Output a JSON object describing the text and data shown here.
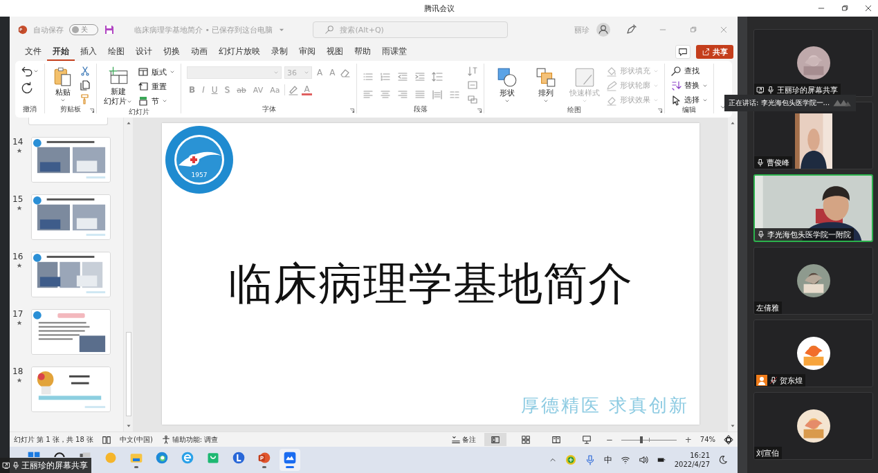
{
  "meeting_window": {
    "title": "腾讯会议"
  },
  "ppt": {
    "autosave": {
      "label": "自动保存",
      "on": false,
      "state_text": "关"
    },
    "document_title": "临床病理学基地简介 • 已保存到这台电脑",
    "search": {
      "placeholder": "搜索(Alt+Q)"
    },
    "user_name": "丽珍",
    "tabs": [
      {
        "label": "文件",
        "selected": false
      },
      {
        "label": "开始",
        "selected": true
      },
      {
        "label": "插入",
        "selected": false
      },
      {
        "label": "绘图",
        "selected": false
      },
      {
        "label": "设计",
        "selected": false
      },
      {
        "label": "切换",
        "selected": false
      },
      {
        "label": "动画",
        "selected": false
      },
      {
        "label": "幻灯片放映",
        "selected": false
      },
      {
        "label": "录制",
        "selected": false
      },
      {
        "label": "审阅",
        "selected": false
      },
      {
        "label": "视图",
        "selected": false
      },
      {
        "label": "帮助",
        "selected": false
      },
      {
        "label": "雨课堂",
        "selected": false
      }
    ],
    "share_button": "共享",
    "ribbon": {
      "undo": {
        "group": "撤消"
      },
      "clipboard": {
        "group": "剪贴板",
        "paste": "粘贴"
      },
      "slides": {
        "group": "幻灯片",
        "new_slide": [
          "新建",
          "幻灯片"
        ],
        "layout": "版式",
        "reset": "重置",
        "section": "节"
      },
      "font": {
        "group": "字体",
        "size": "36",
        "grow_shrink": [
          "A",
          "A"
        ],
        "style_buttons": [
          "B",
          "I",
          "U",
          "S",
          "ab",
          "AV",
          "Aa"
        ],
        "font_color": "A"
      },
      "paragraph": {
        "group": "段落"
      },
      "drawing": {
        "group": "绘图",
        "big": [
          {
            "label": "形状",
            "disabled": false
          },
          {
            "label": "排列",
            "disabled": false
          },
          {
            "label": "快速样式",
            "disabled": true
          }
        ],
        "format": [
          {
            "label": "形状填充",
            "disabled": true
          },
          {
            "label": "形状轮廓",
            "disabled": true
          },
          {
            "label": "形状效果",
            "disabled": true
          }
        ]
      },
      "editing": {
        "group": "编辑",
        "items": [
          "查找",
          "替换",
          "选择"
        ]
      }
    },
    "thumbnails": [
      {
        "number": "14"
      },
      {
        "number": "15"
      },
      {
        "number": "16"
      },
      {
        "number": "17"
      },
      {
        "number": "18"
      }
    ],
    "slide": {
      "logo_year": "1957",
      "title": "临床病理学基地简介",
      "motto": "厚德精医 求真创新"
    },
    "status_bar": {
      "slide_position": "幻灯片 第 1 张，共 18 张",
      "language": "中文(中国)",
      "accessibility": "辅助功能: 调查",
      "notes": "备注",
      "views": [
        {
          "selected": true
        },
        {
          "selected": false
        },
        {
          "selected": false
        },
        {
          "selected": false
        }
      ],
      "zoom": {
        "minus": "−",
        "plus": "+",
        "level": 0.37,
        "percent": "74%"
      }
    },
    "taskbar": {
      "apps": [
        {
          "kind": "start",
          "running": false,
          "selected": false
        },
        {
          "kind": "search",
          "running": false,
          "selected": false
        },
        {
          "kind": "task-view",
          "running": false,
          "selected": false
        },
        {
          "kind": "weather",
          "running": false,
          "selected": false
        },
        {
          "kind": "explorer",
          "running": true,
          "selected": false
        },
        {
          "kind": "edge",
          "running": false,
          "selected": false
        },
        {
          "kind": "browser",
          "running": false,
          "selected": false
        },
        {
          "kind": "store",
          "running": false,
          "selected": false
        },
        {
          "kind": "lapp",
          "running": false,
          "selected": false
        },
        {
          "kind": "powerpoint",
          "running": true,
          "selected": false
        },
        {
          "kind": "meeting",
          "running": true,
          "selected": true
        }
      ],
      "ime": "中",
      "time": "16:21",
      "date": "2022/4/27"
    }
  },
  "participants": [
    {
      "name": "王丽珍的屏幕共享",
      "kind": "avatar",
      "sharing": true,
      "host": false,
      "mic_icon": true,
      "muted": false,
      "speaking": false
    },
    {
      "name": "曹俊峰",
      "kind": "video",
      "sharing": false,
      "host": false,
      "mic_icon": true,
      "muted": false,
      "speaking": false
    },
    {
      "name": "李光海包头医学院一附院",
      "kind": "video-wide",
      "sharing": false,
      "host": false,
      "mic_icon": true,
      "muted": false,
      "speaking": true
    },
    {
      "name": "左倩雅",
      "kind": "avatar",
      "sharing": false,
      "host": false,
      "mic_icon": false,
      "speaking": false
    },
    {
      "name": "贺东煌",
      "kind": "avatar",
      "sharing": false,
      "host": true,
      "mic_icon": true,
      "muted": true,
      "speaking": false
    },
    {
      "name": "刘宣伯",
      "kind": "avatar",
      "sharing": false,
      "host": false,
      "mic_icon": false,
      "speaking": false
    }
  ],
  "speaking_banner": "正在讲话: 李光海包头医学院一...",
  "share_overlay": "王丽珍的屏幕共享"
}
